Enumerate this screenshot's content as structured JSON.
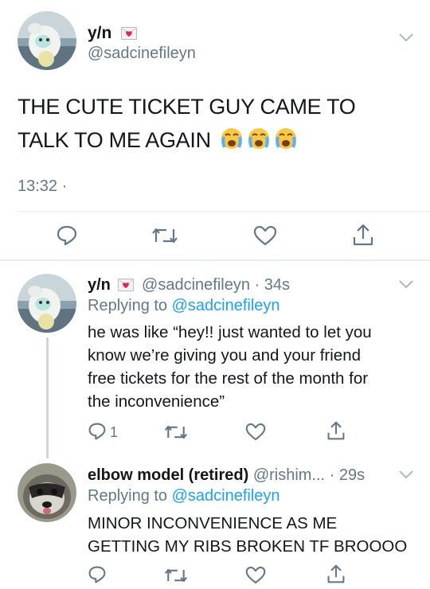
{
  "main_tweet": {
    "display_name": "y/n",
    "handle": "@sadcinefileyn",
    "text": "THE CUTE TICKET GUY CAME TO TALK TO ME AGAIN",
    "emojis": [
      "crying-face",
      "crying-face",
      "crying-face"
    ],
    "time": "13:32 ·"
  },
  "reply1": {
    "display_name": "y/n",
    "handle": "@sadcinefileyn",
    "time": "· 34s",
    "replying_prefix": "Replying to",
    "replying_handle": "@sadcinefileyn",
    "text_lines": [
      "he was like “hey!! just wanted to let you",
      "know we’re giving you and your friend",
      "free tickets for the rest of the month for",
      "the inconvenience”"
    ],
    "reply_count": "1"
  },
  "reply2": {
    "display_name": "elbow model (retired)",
    "handle": "@rishim...",
    "time": "· 29s",
    "replying_prefix": "Replying to",
    "replying_handle": "@sadcinefileyn",
    "text_lines": [
      "MINOR INCONVENIENCE AS ME",
      "GETTING MY RIBS BROKEN TF BROOOO"
    ]
  },
  "colors": {
    "accent": "#1da1f2",
    "muted": "#657786",
    "heart": "#e0245e",
    "divider": "#e6ecf0"
  }
}
